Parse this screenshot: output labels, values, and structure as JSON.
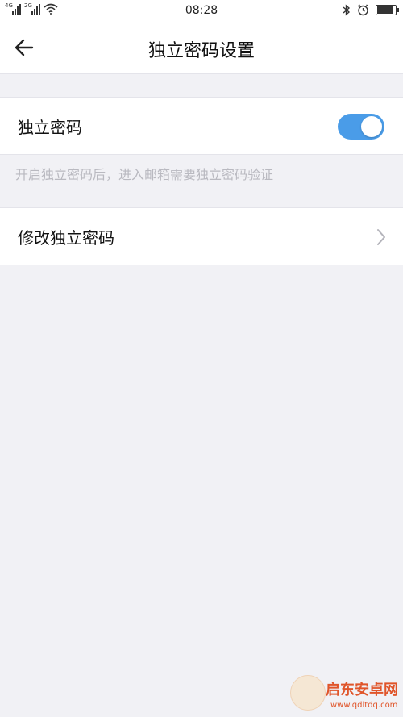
{
  "status_bar": {
    "time": "08:28",
    "sim1": "4G",
    "sim2": "2G",
    "battery_percent": 95
  },
  "nav": {
    "title": "独立密码设置"
  },
  "independent_password": {
    "label": "独立密码",
    "enabled": true,
    "hint": "开启独立密码后，进入邮箱需要独立密码验证"
  },
  "change_password": {
    "label": "修改独立密码"
  },
  "watermark": {
    "brand": "启东安卓网",
    "url": "www.qdltdq.com"
  },
  "colors": {
    "accent": "#4a9ce8",
    "background": "#f1f1f5"
  }
}
